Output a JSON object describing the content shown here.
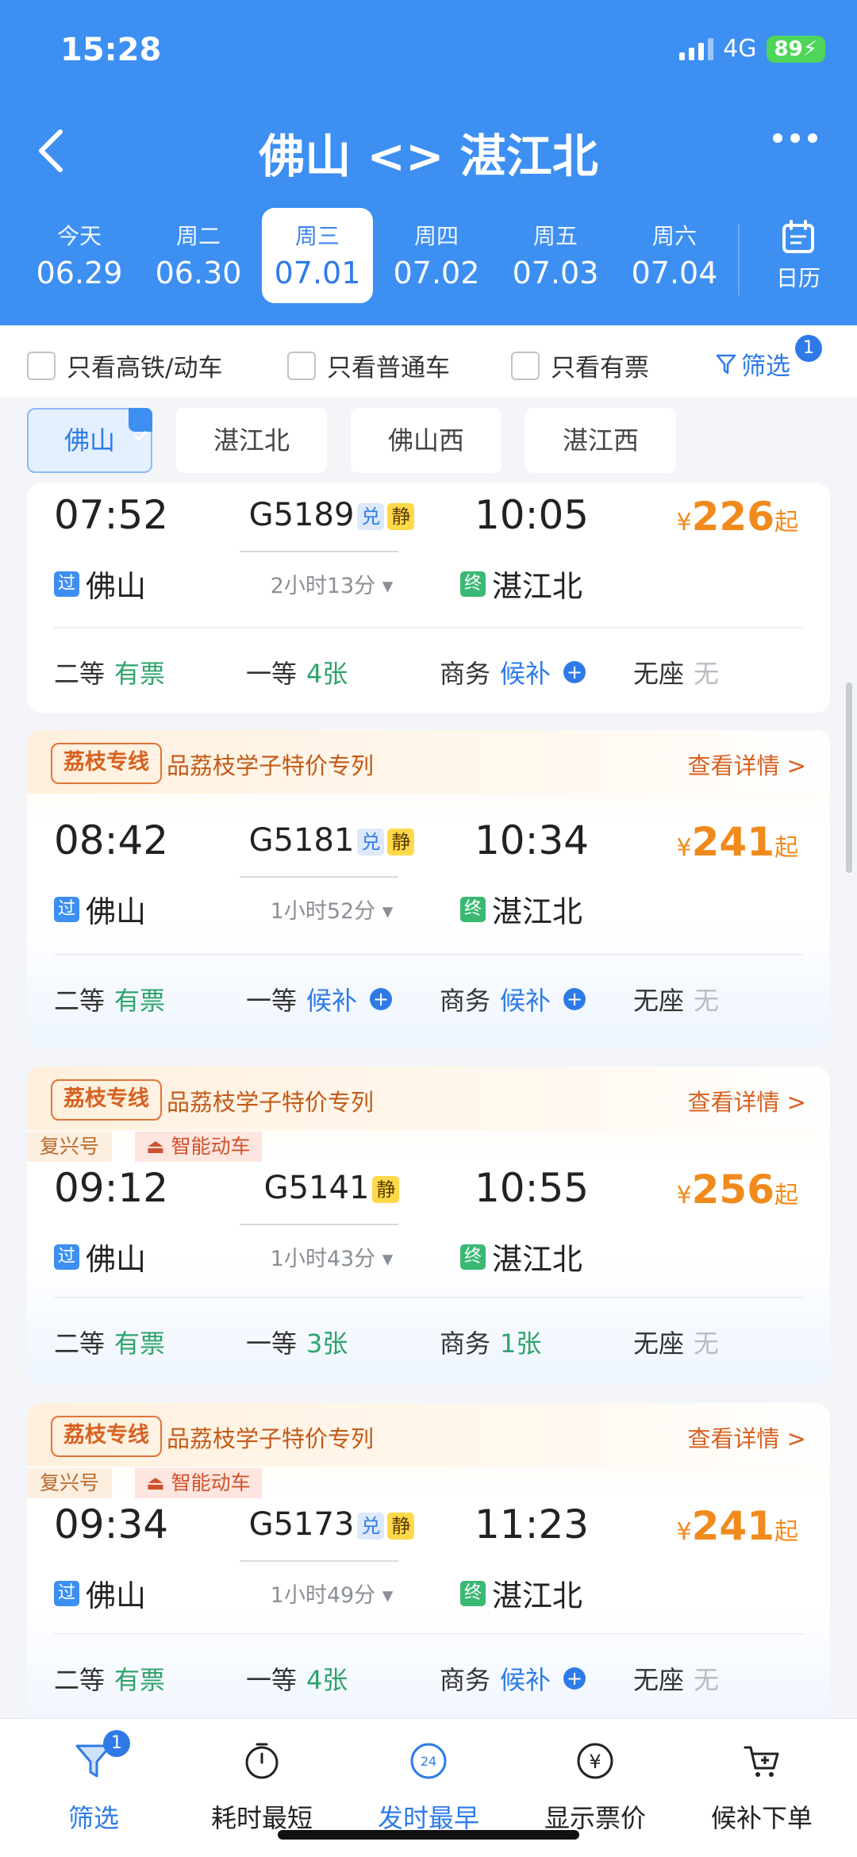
{
  "status": {
    "time": "15:28",
    "network": "4G",
    "battery": "89"
  },
  "nav": {
    "title": "佛山 <> 湛江北"
  },
  "dates": [
    {
      "weekday": "今天",
      "date": "06.29"
    },
    {
      "weekday": "周二",
      "date": "06.30"
    },
    {
      "weekday": "周三",
      "date": "07.01"
    },
    {
      "weekday": "周四",
      "date": "07.02"
    },
    {
      "weekday": "周五",
      "date": "07.03"
    },
    {
      "weekday": "周六",
      "date": "07.04"
    }
  ],
  "active_date_index": 2,
  "calendar_label": "日历",
  "filters": {
    "gaotie": "只看高铁/动车",
    "putong": "只看普通车",
    "youpiao": "只看有票",
    "filter_label": "筛选",
    "filter_count": "1"
  },
  "stations": [
    "佛山",
    "湛江北",
    "佛山西",
    "湛江西"
  ],
  "promo": {
    "tag": "荔枝专线",
    "text": "品荔枝学子特价专列",
    "link": "查看详情 >"
  },
  "train_tags": {
    "fuxing": "复兴号",
    "zhineng": "智能动车"
  },
  "badges": {
    "dui": "兑",
    "jing": "静",
    "guo": "过",
    "zhong": "终"
  },
  "trains": [
    {
      "depart": "07:52",
      "arrive": "10:05",
      "number": "G5189",
      "duration": "2小时13分",
      "from": "佛山",
      "to": "湛江北",
      "price_symbol": "¥",
      "price": "226",
      "price_suffix": "起",
      "seats": [
        {
          "name": "二等",
          "status": "有票"
        },
        {
          "name": "一等",
          "status": "4张"
        },
        {
          "name": "商务",
          "status": "候补"
        },
        {
          "name": "无座",
          "status": "无"
        }
      ]
    },
    {
      "depart": "08:42",
      "arrive": "10:34",
      "number": "G5181",
      "duration": "1小时52分",
      "from": "佛山",
      "to": "湛江北",
      "price_symbol": "¥",
      "price": "241",
      "price_suffix": "起",
      "seats": [
        {
          "name": "二等",
          "status": "有票"
        },
        {
          "name": "一等",
          "status": "候补"
        },
        {
          "name": "商务",
          "status": "候补"
        },
        {
          "name": "无座",
          "status": "无"
        }
      ]
    },
    {
      "depart": "09:12",
      "arrive": "10:55",
      "number": "G5141",
      "duration": "1小时43分",
      "from": "佛山",
      "to": "湛江北",
      "price_symbol": "¥",
      "price": "256",
      "price_suffix": "起",
      "seats": [
        {
          "name": "二等",
          "status": "有票"
        },
        {
          "name": "一等",
          "status": "3张"
        },
        {
          "name": "商务",
          "status": "1张"
        },
        {
          "name": "无座",
          "status": "无"
        }
      ]
    },
    {
      "depart": "09:34",
      "arrive": "11:23",
      "number": "G5173",
      "duration": "1小时49分",
      "from": "佛山",
      "to": "湛江北",
      "price_symbol": "¥",
      "price": "241",
      "price_suffix": "起",
      "seats": [
        {
          "name": "二等",
          "status": "有票"
        },
        {
          "name": "一等",
          "status": "4张"
        },
        {
          "name": "商务",
          "status": "候补"
        },
        {
          "name": "无座",
          "status": "无"
        }
      ]
    }
  ],
  "bottom": {
    "filter": "筛选",
    "filter_count": "1",
    "shortest": "耗时最短",
    "earliest": "发时最早",
    "earliest_icon_text": "24",
    "show_price": "显示票价",
    "waitlist": "候补下单"
  },
  "colors": {
    "brand": "#3d8ff2",
    "price": "#f08a1c",
    "available": "#2ea36b",
    "promo": "#d8601f"
  }
}
